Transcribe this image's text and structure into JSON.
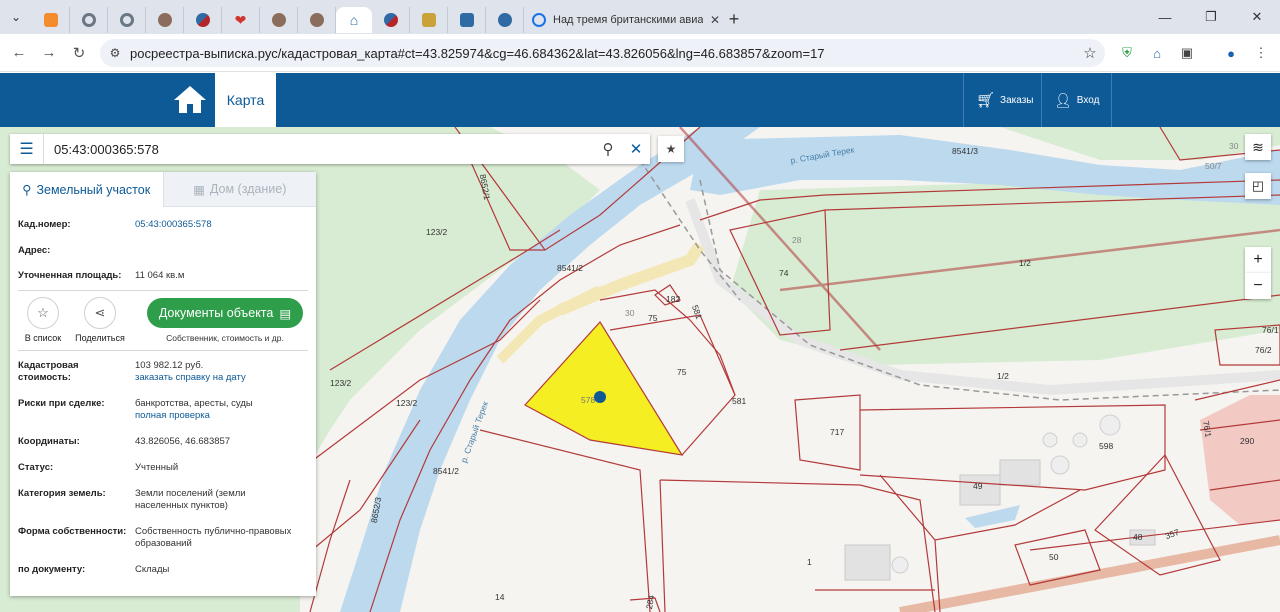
{
  "browser": {
    "tabs": [
      {
        "icon": "chevron-down-icon"
      },
      {
        "icon": "odnoklassniki-icon",
        "color": "#f48c2f"
      },
      {
        "icon": "site-icon",
        "color": "#6a7785"
      },
      {
        "icon": "site-icon",
        "color": "#6a7785"
      },
      {
        "icon": "avatar-icon",
        "color": "#8a6d5c"
      },
      {
        "icon": "flag-icon",
        "color": "#b5262b"
      },
      {
        "icon": "heart-icon",
        "color": "#d0362d"
      },
      {
        "icon": "avatar-icon",
        "color": "#8a6d5c"
      },
      {
        "icon": "avatar-icon",
        "color": "#8a6d5c"
      },
      {
        "icon": "rosreestr-icon",
        "color": "#2f6aa4"
      },
      {
        "icon": "flag-icon",
        "color": "#b5262b"
      },
      {
        "icon": "emblem-icon",
        "color": "#c9a33a"
      },
      {
        "icon": "emblem-icon",
        "color": "#2f6aa4"
      },
      {
        "icon": "globe-icon",
        "color": "#2f6aa4"
      }
    ],
    "active_tab_title": "Над тремя британскими авиа",
    "url": "росреестра-выписка.рус/кадастровая_карта#ct=43.825974&cg=46.684362&lat=43.826056&lng=46.683857&zoom=17"
  },
  "header": {
    "map_tab": "Карта",
    "orders": "Заказы",
    "login": "Вход",
    "brand_color": "#0d5a97"
  },
  "search": {
    "query": "05:43:000365:578"
  },
  "panel": {
    "tab_land": "Земельный участок",
    "tab_building": "Дом (здание)",
    "cadnum_label": "Кад.номер:",
    "cadnum_value": "05:43:000365:578",
    "address_label": "Адрес:",
    "area_label": "Уточненная площадь:",
    "area_value": "11 064 кв.м",
    "to_list": "В список",
    "share": "Поделиться",
    "docs_button": "Документы объекта",
    "docs_sub": "Собственник, стоимость и др.",
    "cost_label": "Кадастровая стоимость:",
    "cost_value": "103 982.12 руб.",
    "cost_link": "заказать справку на дату",
    "risks_label": "Риски при сделке:",
    "risks_value": "банкротства, аресты, суды",
    "risks_link": "полная проверка",
    "coords_label": "Координаты:",
    "coords_value": "43.826056, 46.683857",
    "status_label": "Статус:",
    "status_value": "Учтенный",
    "category_label": "Категория земель:",
    "category_value": "Земли поселений (земли населенных пунктов)",
    "ownership_label": "Форма собственности:",
    "ownership_value": "Собственность публично-правовых образований",
    "doc_label": "по документу:",
    "doc_value": "Склады",
    "accent_green": "#2e9e4b"
  },
  "map": {
    "labels": {
      "river1": "р. Старый Терек",
      "river2": "р. Старый Терек",
      "p8541_3": "8541/3",
      "p8541_2a": "8541/2",
      "p8541_2b": "8541/2",
      "p8652_1": "8652/1",
      "p8652_3": "8652/3",
      "p123_2a": "123/2",
      "p123_2b": "123/2",
      "p123_2c": "123/2",
      "p578": "578",
      "p75a": "75",
      "p75b": "75",
      "p30": "30",
      "p182": "182",
      "p581a": "581",
      "p581b": "581",
      "p28": "28",
      "p74": "74",
      "p1_2a": "1/2",
      "p1_2b": "1/2",
      "p717": "717",
      "p598": "598",
      "p49": "49",
      "p48": "48",
      "p50": "50",
      "p1": "1",
      "p14": "14",
      "p284": "284",
      "p357": "357",
      "p290": "290",
      "p76_1a": "76/1",
      "p76_1b": "76/1",
      "p76_2": "76/2",
      "p30top": "30",
      "p507": "50/7"
    },
    "zoom_in": "+",
    "zoom_out": "−",
    "parcel_color": "#f4ee22",
    "border_color": "#b33a3a",
    "water_color": "#bcd9ee"
  }
}
